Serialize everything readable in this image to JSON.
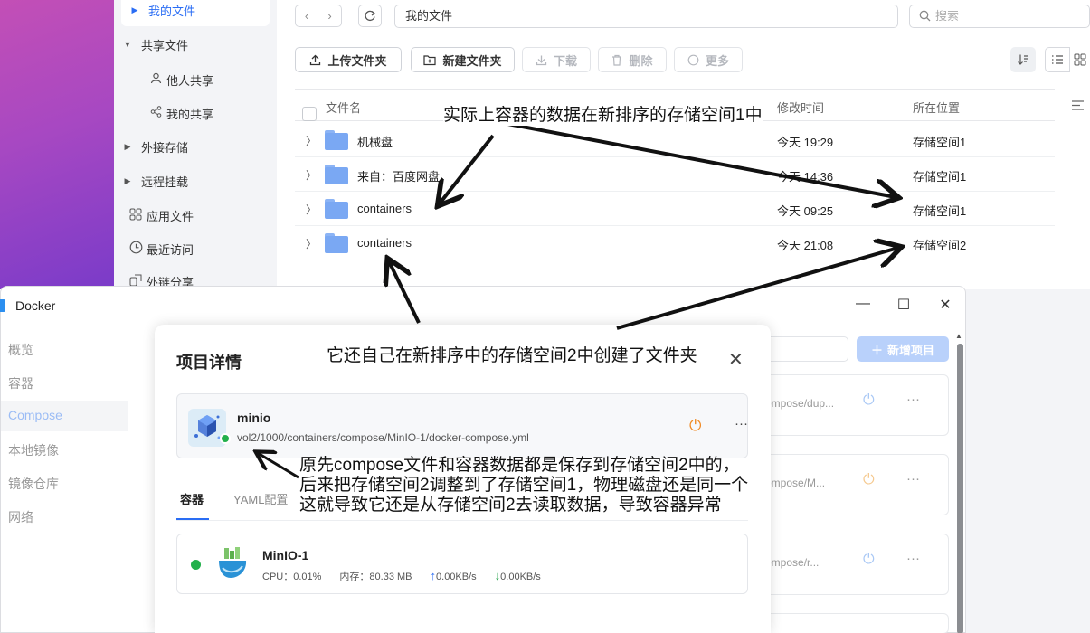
{
  "file_manager": {
    "sidebar": [
      {
        "label": "我的文件",
        "icon": "triangle-right-icon",
        "active": true
      },
      {
        "label": "共享文件",
        "icon": "triangle-down-icon"
      },
      {
        "label": "他人共享",
        "icon": "person-icon"
      },
      {
        "label": "我的共享",
        "icon": "share-icon"
      },
      {
        "label": "外接存储",
        "icon": "triangle-right-icon"
      },
      {
        "label": "远程挂载",
        "icon": "triangle-right-icon"
      },
      {
        "label": "应用文件",
        "icon": "apps-grid-icon"
      },
      {
        "label": "最近访问",
        "icon": "clock-icon"
      },
      {
        "label": "外链分享",
        "icon": "link-icon"
      }
    ],
    "path": "我的文件",
    "search_placeholder": "搜索",
    "toolbar": {
      "upload": "上传文件夹",
      "new_folder": "新建文件夹",
      "download": "下载",
      "delete": "删除",
      "more": "更多"
    },
    "columns": {
      "name": "文件名",
      "modified": "修改时间",
      "location": "所在位置"
    },
    "rows": [
      {
        "name": "机械盘",
        "time": "今天 19:29",
        "location": "存储空间1"
      },
      {
        "name": "来自：百度网盘",
        "time": "今天 14:36",
        "location": "存储空间1"
      },
      {
        "name": "containers",
        "time": "今天 09:25",
        "location": "存储空间1"
      },
      {
        "name": "containers",
        "time": "今天 21:08",
        "location": "存储空间2"
      }
    ]
  },
  "docker": {
    "title": "Docker",
    "sidebar": [
      "概览",
      "容器",
      "Compose",
      "本地镜像",
      "镜像仓库",
      "网络"
    ],
    "active_sidebar": "Compose",
    "add_button": "新增项目",
    "bg_projects": [
      {
        "path": "ompose/dup...",
        "power_color": "#a9c8f5"
      },
      {
        "path": "ompose/M...",
        "power_color": "#f5c98f"
      },
      {
        "path": "ompose/r...",
        "power_color": "#a9c8f5"
      }
    ]
  },
  "dialog": {
    "title": "项目详情",
    "service": {
      "name": "minio",
      "path": "vol2/1000/containers/compose/MinIO-1/docker-compose.yml",
      "status_color": "#22b04b"
    },
    "tabs": [
      "容器",
      "YAML配置"
    ],
    "container": {
      "name": "MinIO-1",
      "cpu": "CPU：0.01%",
      "memory": "内存：80.33 MB",
      "upload": "0.00KB/s",
      "download": "0.00KB/s"
    }
  },
  "annotations": {
    "top": "实际上容器的数据在新排序的存储空间1中",
    "middle": "它还自己在新排序中的存储空间2中创建了文件夹",
    "bottom": [
      "原先compose文件和容器数据都是保存到存储空间2中的，",
      "后来把存储空间2调整到了存储空间1，物理磁盘还是同一个",
      "这就导致它还是从存储空间2去读取数据，导致容器异常"
    ]
  },
  "colors": {
    "accent": "#2a6df4",
    "running": "#22b04b",
    "power_orange": "#f08a24"
  }
}
